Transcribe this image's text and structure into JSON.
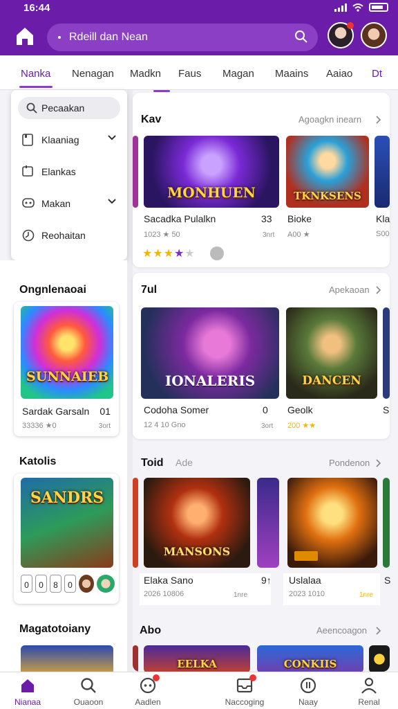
{
  "status": {
    "time": "16:44"
  },
  "search": {
    "text": "Rdeill dan Nean"
  },
  "tabs": [
    "Nanka",
    "Nenagan",
    "Madkn",
    "Faus",
    "Magan",
    "Maains",
    "Aaiao",
    "Dt"
  ],
  "dropdown": {
    "search_label": "Pecaakan",
    "items": [
      {
        "label": "Klaaniag",
        "icon": "bookmark-icon",
        "has_chevron": true
      },
      {
        "label": "Elankas",
        "icon": "calendar-icon",
        "has_chevron": false
      },
      {
        "label": "Makan",
        "icon": "gamepad-icon",
        "has_chevron": true
      },
      {
        "label": "Reohaitan",
        "icon": "clock-icon",
        "has_chevron": false
      }
    ]
  },
  "left": {
    "sections": [
      {
        "title": "Ongnlenaoai",
        "card": {
          "art_text": "SUNNAIEB",
          "name": "Sardak Garsaln",
          "meta": "33336 ★0",
          "meta_right": "3ort",
          "count": "01"
        }
      },
      {
        "title": "Katolis",
        "card": {
          "art_text": "SANDRS",
          "name": "",
          "meta": "",
          "meta_right": "",
          "count": ""
        }
      },
      {
        "title": "Magatotoiany",
        "card": {
          "art_text": "",
          "name": "",
          "meta": "",
          "meta_right": "",
          "count": ""
        }
      }
    ],
    "mini_icons": [
      "0",
      "0",
      "8",
      "0"
    ]
  },
  "rows": [
    {
      "title": "Kav",
      "sub": "",
      "link": "Agoagkn inearn",
      "cards": [
        {
          "art_text": "MONHUEN",
          "name": "Sacadka Pulalkn",
          "meta": "1023 ★ 50",
          "right": "33",
          "right_sub": "3nrt"
        },
        {
          "art_text": "TKNKSENS",
          "name": "Bioke",
          "meta": "A00 ★",
          "right": "",
          "right_sub": ""
        },
        {
          "art_text": "",
          "name": "Kla",
          "meta": "S00",
          "right": "",
          "right_sub": ""
        }
      ],
      "rating": 4
    },
    {
      "title": "7ul",
      "sub": "",
      "link": "Apekaoan",
      "cards": [
        {
          "art_text": "IONALERIS",
          "name": "Codoha Somer",
          "meta": "12 4 10 Gno",
          "right": "0",
          "right_sub": "3ort"
        },
        {
          "art_text": "DANCEN",
          "name": "Geolk",
          "meta": "200 ★★",
          "right": "",
          "right_sub": ""
        },
        {
          "art_text": "",
          "name": "S",
          "meta": "",
          "right": "",
          "right_sub": ""
        }
      ]
    },
    {
      "title": "Toid",
      "sub": "Ade",
      "link": "Pondenon",
      "cards": [
        {
          "art_text": "MANSONS",
          "name": "Elaka Sano",
          "meta": "2026 10806",
          "right": "9↑",
          "right_sub": "1nre"
        },
        {
          "art_text": "",
          "name": "Uslalaa",
          "meta": "2023 1010",
          "right": "",
          "right_sub": "1nre"
        },
        {
          "art_text": "",
          "name": "S",
          "meta": "",
          "right": "",
          "right_sub": ""
        }
      ]
    },
    {
      "title": "Abo",
      "sub": "",
      "link": "Aeencoagon",
      "cards": [
        {
          "art_text": "EELKA",
          "name": "",
          "meta": "",
          "right": "",
          "right_sub": ""
        },
        {
          "art_text": "CONKIIS",
          "name": "",
          "meta": "",
          "right": "",
          "right_sub": ""
        }
      ]
    }
  ],
  "bottom_nav": [
    {
      "label": "Nianaa",
      "icon": "home-icon",
      "badge": false
    },
    {
      "label": "Ouaoon",
      "icon": "search-icon",
      "badge": false
    },
    {
      "label": "Aadlen",
      "icon": "controller-icon",
      "badge": true
    },
    {
      "label": "Naccoging",
      "icon": "inbox-icon",
      "badge": true
    },
    {
      "label": "Naay",
      "icon": "music-icon",
      "badge": false
    },
    {
      "label": "Renal",
      "icon": "profile-icon",
      "badge": false
    }
  ],
  "colors": {
    "accent": "#6b1ca8",
    "star": "#f4b400",
    "star_purple": "#7a2cc4"
  }
}
